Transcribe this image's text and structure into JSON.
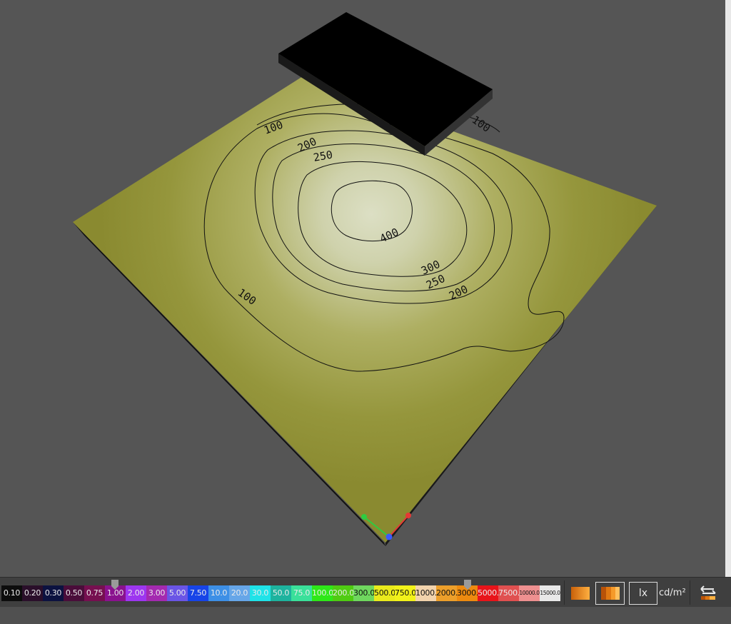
{
  "viewport": {
    "contour_labels": [
      "100",
      "200",
      "250",
      "400",
      "300",
      "250",
      "200",
      "100",
      "100"
    ],
    "axis_colors": {
      "x": "#e53935",
      "y": "#2ecc40",
      "z": "#3b5bff"
    },
    "floor_color": "#8c8c34",
    "object_color": "#000000"
  },
  "scale": {
    "values": [
      "0.10",
      "0.20",
      "0.30",
      "0.50",
      "0.75",
      "1.00",
      "2.00",
      "3.00",
      "5.00",
      "7.50",
      "10.0",
      "20.0",
      "30.0",
      "50.0",
      "75.0",
      "100.0",
      "200.0",
      "300.0",
      "500.0",
      "750.0",
      "1000.0",
      "2000.0",
      "3000.0",
      "5000.0",
      "7500.0",
      "10000.0",
      "15000.0"
    ],
    "colors": [
      "#0d0d0d",
      "#2a0f2a",
      "#0c1240",
      "#4a0d3a",
      "#760f50",
      "#8a128e",
      "#9d36f0",
      "#a42ab0",
      "#6a55e6",
      "#1744e8",
      "#3d8fe6",
      "#66a6e8",
      "#1fe3e8",
      "#1db39e",
      "#3ae09a",
      "#2ee818",
      "#4fcc12",
      "#6fd75e",
      "#eaea1c",
      "#f2f21a",
      "#f2d3ac",
      "#ed9f2a",
      "#ed8a0f",
      "#e8141a",
      "#e05050",
      "#ee9090",
      "#e8e8e8"
    ],
    "min_marker_value": "1.00",
    "max_marker_value": "3000.0"
  },
  "toolbar": {
    "unit_lx": "lx",
    "unit_cd": "cd/m²",
    "gradient_solid_icon": "gradient-solid-icon",
    "gradient_steps_icon": "gradient-steps-icon",
    "swap_icon": "swap-arrows-icon"
  }
}
